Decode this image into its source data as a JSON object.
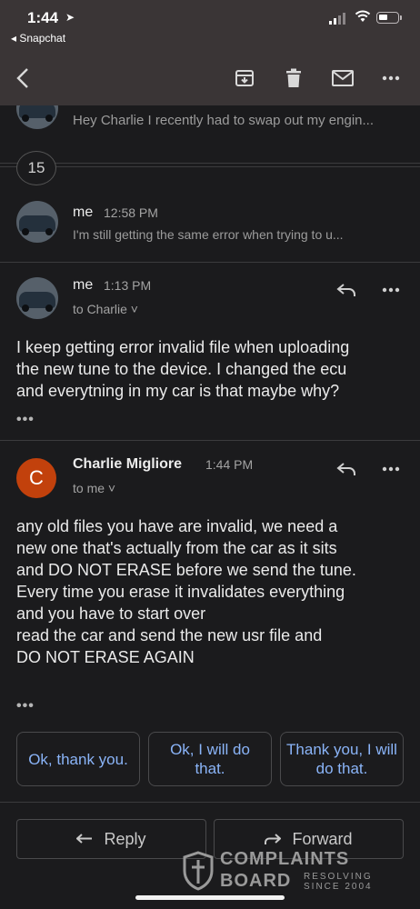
{
  "status_bar": {
    "time": "1:44",
    "back_app": "◂ Snapchat"
  },
  "thread": {
    "collapsed_preview": "Hey Charlie I recently had to swap out my engin...",
    "collapsed_count": "15",
    "message_1": {
      "sender": "me",
      "time": "12:58 PM",
      "snippet": "I'm still getting the same error when trying to u..."
    },
    "message_2": {
      "sender": "me",
      "time": "1:13 PM",
      "to": "to Charlie ˅",
      "body": [
        "I keep getting error invalid file when uploading",
        "the new tune to the device. I changed the ecu",
        "and everytning in my car is that maybe why?"
      ],
      "more": "•••"
    },
    "message_3": {
      "avatar_letter": "C",
      "avatar_color": "#c2410c",
      "sender": "Charlie Migliore",
      "time": "1:44 PM",
      "to": "to me ˅",
      "body": [
        "any old files you have are invalid, we need a",
        "new one that's actually from the car as it sits",
        "and DO NOT ERASE before we send the tune.",
        "Every time you erase it invalidates everything",
        "and you have to start over",
        "read the car and send the new usr file  and",
        "DO NOT ERASE AGAIN"
      ],
      "more": "•••"
    }
  },
  "smart_replies": [
    "Ok, thank you.",
    "Ok, I will do that.",
    "Thank you, I will do that."
  ],
  "actions": {
    "reply": "Reply",
    "forward": "Forward"
  },
  "watermark": {
    "title": "COMPLAINTS",
    "board": "BOARD",
    "sub1": "RESOLVING",
    "sub2": "SINCE 2004"
  },
  "colors": {
    "accent_link": "#8ab4f8",
    "toolbar_bg": "#3a3536",
    "page_bg": "#1b1b1d"
  }
}
